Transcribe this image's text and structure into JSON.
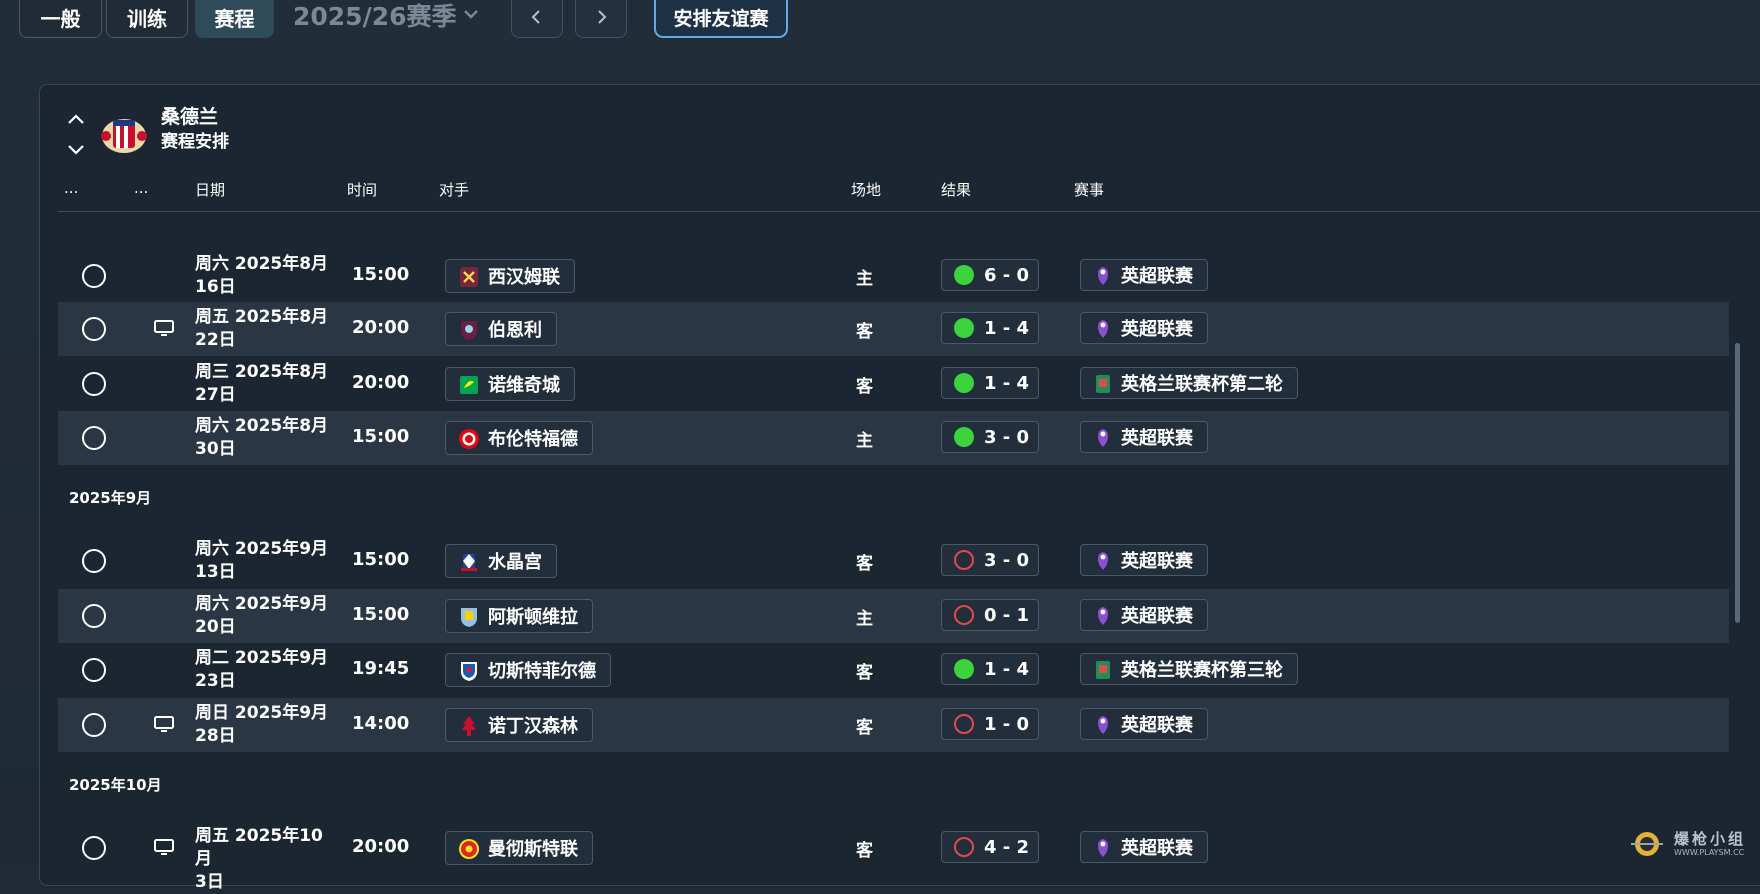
{
  "toolbar": {
    "tabs": [
      {
        "label": "一般"
      },
      {
        "label": "训练"
      },
      {
        "label": "赛程"
      }
    ],
    "active_tab": "赛程",
    "season_label": "2025/26赛季",
    "friendly_label": "安排友谊赛"
  },
  "team": {
    "name": "桑德兰",
    "subtitle": "赛程安排"
  },
  "columns": {
    "more1": "...",
    "more2": "...",
    "date": "日期",
    "time": "时间",
    "opponent": "对手",
    "venue": "场地",
    "result": "结果",
    "competition": "赛事"
  },
  "months": [
    {
      "label": "2025年9月"
    },
    {
      "label": "2025年10月"
    }
  ],
  "fixtures": [
    {
      "date_line1": "周六 2025年8月",
      "date_line2": "16日",
      "time": "15:00",
      "opponent": "西汉姆联",
      "venue": "主",
      "outcome": "win",
      "score": "6 - 0",
      "competition": "英超联赛",
      "comp_type": "premier",
      "tv": false
    },
    {
      "date_line1": "周五 2025年8月",
      "date_line2": "22日",
      "time": "20:00",
      "opponent": "伯恩利",
      "venue": "客",
      "outcome": "win",
      "score": "1 - 4",
      "competition": "英超联赛",
      "comp_type": "premier",
      "tv": true
    },
    {
      "date_line1": "周三 2025年8月",
      "date_line2": "27日",
      "time": "20:00",
      "opponent": "诺维奇城",
      "venue": "客",
      "outcome": "win",
      "score": "1 - 4",
      "competition": "英格兰联赛杯第二轮",
      "comp_type": "cup",
      "tv": false
    },
    {
      "date_line1": "周六 2025年8月",
      "date_line2": "30日",
      "time": "15:00",
      "opponent": "布伦特福德",
      "venue": "主",
      "outcome": "win",
      "score": "3 - 0",
      "competition": "英超联赛",
      "comp_type": "premier",
      "tv": false
    },
    {
      "date_line1": "周六 2025年9月",
      "date_line2": "13日",
      "time": "15:00",
      "opponent": "水晶宫",
      "venue": "客",
      "outcome": "loss",
      "score": "3 - 0",
      "competition": "英超联赛",
      "comp_type": "premier",
      "tv": false
    },
    {
      "date_line1": "周六 2025年9月",
      "date_line2": "20日",
      "time": "15:00",
      "opponent": "阿斯顿维拉",
      "venue": "主",
      "outcome": "loss",
      "score": "0 - 1",
      "competition": "英超联赛",
      "comp_type": "premier",
      "tv": false
    },
    {
      "date_line1": "周二 2025年9月",
      "date_line2": "23日",
      "time": "19:45",
      "opponent": "切斯特菲尔德",
      "venue": "客",
      "outcome": "win",
      "score": "1 - 4",
      "competition": "英格兰联赛杯第三轮",
      "comp_type": "cup",
      "tv": false
    },
    {
      "date_line1": "周日 2025年9月",
      "date_line2": "28日",
      "time": "14:00",
      "opponent": "诺丁汉森林",
      "venue": "客",
      "outcome": "loss",
      "score": "1 - 0",
      "competition": "英超联赛",
      "comp_type": "premier",
      "tv": true
    },
    {
      "date_line1": "周五 2025年10月",
      "date_line2": "3日",
      "time": "20:00",
      "opponent": "曼彻斯特联",
      "venue": "客",
      "outcome": "loss",
      "score": "4 - 2",
      "competition": "英超联赛",
      "comp_type": "premier",
      "tv": true
    }
  ],
  "opponent_icons": [
    "west-ham-crest-icon",
    "burnley-crest-icon",
    "norwich-crest-icon",
    "brentford-crest-icon",
    "crystal-palace-crest-icon",
    "aston-villa-crest-icon",
    "chesterfield-crest-icon",
    "nottingham-forest-crest-icon",
    "manchester-united-crest-icon"
  ],
  "colors": {
    "win": "#3dd33d",
    "loss": "#e14a4a",
    "accent": "#66a9e8",
    "active_tab": "#2f4a58"
  },
  "watermark": {
    "text": "爆枪小组",
    "url": "WWW.PLAYSM.CC"
  }
}
